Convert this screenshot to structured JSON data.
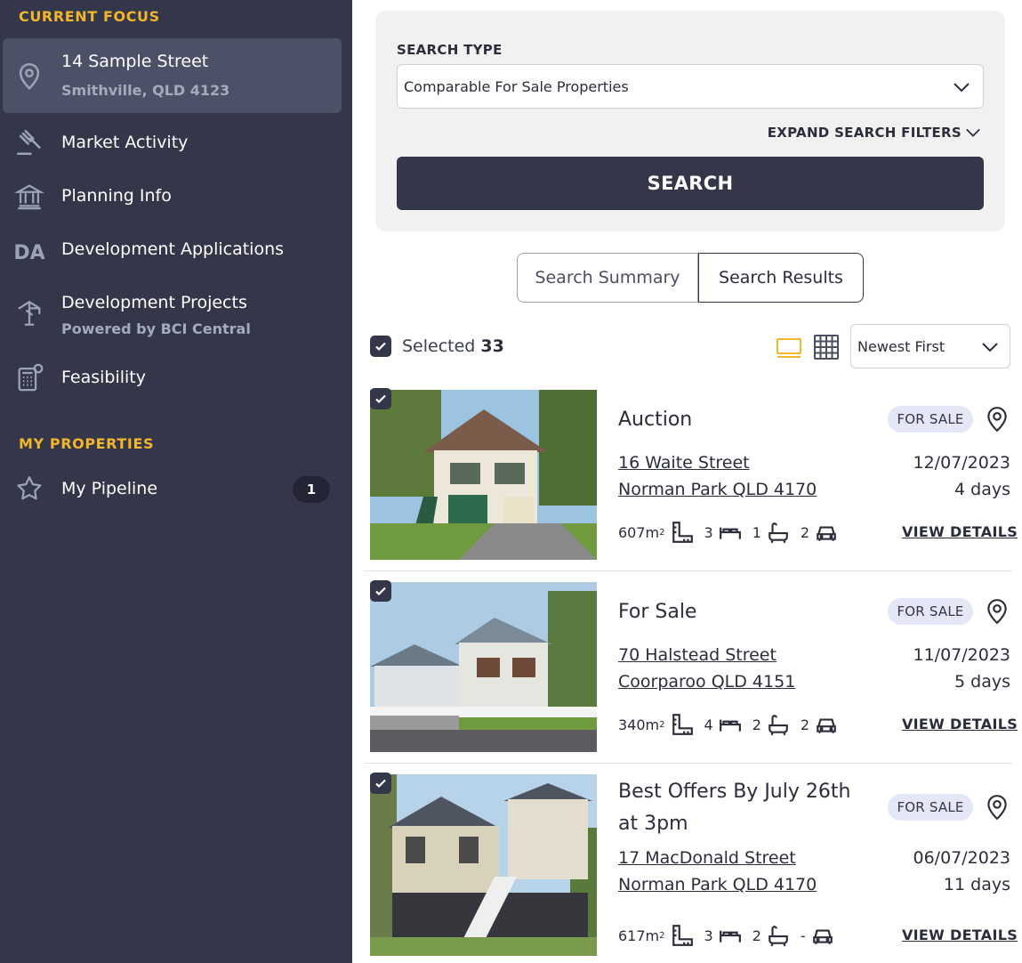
{
  "sidebar": {
    "current_focus_heading": "CURRENT FOCUS",
    "focus": {
      "street": "14 Sample Street",
      "suburb": "Smithville, QLD 4123",
      "icon": "location-pin-icon"
    },
    "items": [
      {
        "label": "Market Activity",
        "icon": "gavel-icon"
      },
      {
        "label": "Planning Info",
        "icon": "government-building-icon"
      },
      {
        "label": "Development Applications",
        "icon": "da-text-icon",
        "icon_text": "DA"
      },
      {
        "label": "Development Projects",
        "sub": "Powered by BCI Central",
        "icon": "crane-icon"
      },
      {
        "label": "Feasibility",
        "icon": "calculator-icon"
      }
    ],
    "my_properties_heading": "MY PROPERTIES",
    "pipeline": {
      "label": "My Pipeline",
      "count": "1",
      "icon": "star-icon"
    }
  },
  "search": {
    "type_label": "SEARCH TYPE",
    "type_value": "Comparable For Sale Properties",
    "expand_label": "EXPAND SEARCH FILTERS",
    "button_label": "SEARCH"
  },
  "tabs": {
    "summary": "Search Summary",
    "results": "Search Results"
  },
  "results": {
    "selected_label": "Selected",
    "selected_count": "33",
    "sort_value": "Newest First",
    "colors": {
      "accent": "#f2b52b",
      "dark": "#343749",
      "pill_bg": "#e4e7f5"
    },
    "listings": [
      {
        "headline": "Auction",
        "status": "FOR SALE",
        "street": "16 Waite Street",
        "suburb": "Norman Park QLD 4170",
        "date": "12/07/2023",
        "days": "4 days",
        "land": "607m",
        "land_sup": "2",
        "beds": "3",
        "baths": "1",
        "cars": "2",
        "details_label": "VIEW DETAILS"
      },
      {
        "headline": "For Sale",
        "status": "FOR SALE",
        "street": "70 Halstead Street",
        "suburb": "Coorparoo QLD 4151",
        "date": "11/07/2023",
        "days": "5 days",
        "land": "340m",
        "land_sup": "2",
        "beds": "4",
        "baths": "2",
        "cars": "2",
        "details_label": "VIEW DETAILS"
      },
      {
        "headline": "Best Offers By July 26th at 3pm",
        "status": "FOR SALE",
        "street": "17 MacDonald Street",
        "suburb": "Norman Park QLD 4170",
        "date": "06/07/2023",
        "days": "11 days",
        "land": "617m",
        "land_sup": "2",
        "beds": "3",
        "baths": "2",
        "cars": "-",
        "details_label": "VIEW DETAILS"
      }
    ]
  }
}
